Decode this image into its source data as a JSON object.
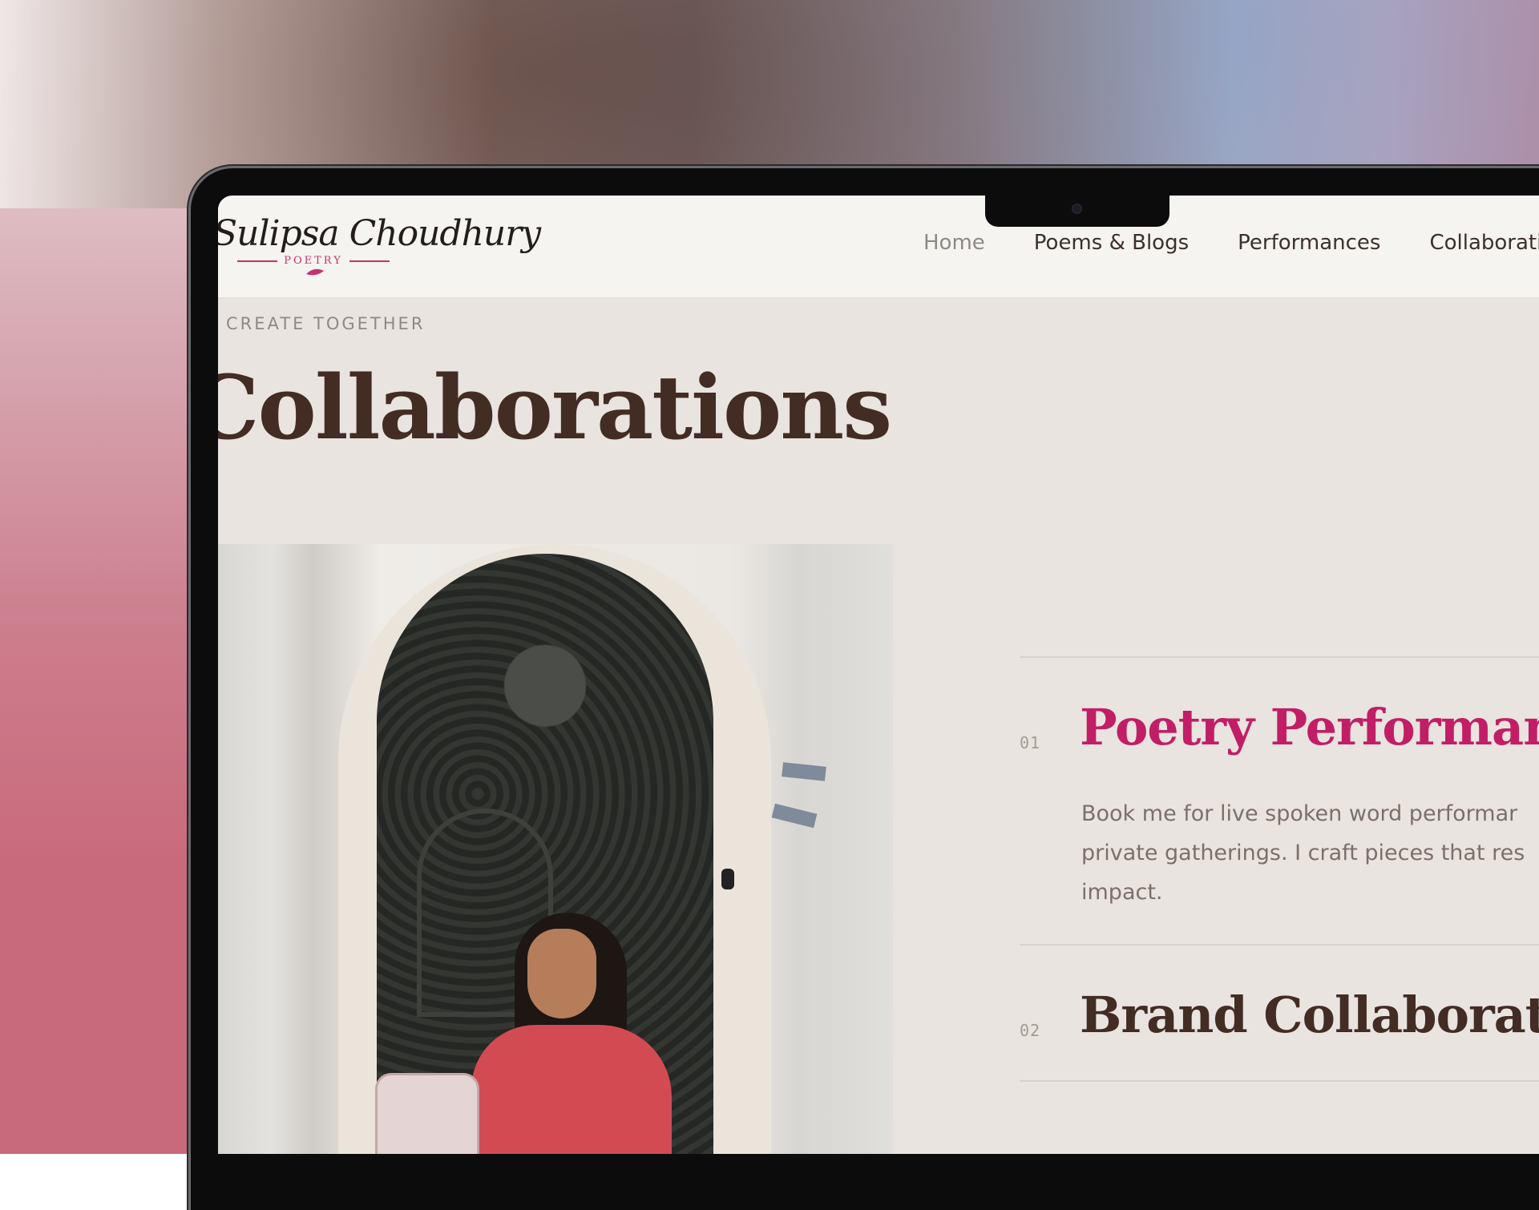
{
  "brand": {
    "name": "Sulipsa Choudhury",
    "tagline": "POETRY",
    "accent_color": "#c11e66",
    "title_color": "#432c24"
  },
  "nav": {
    "items": [
      {
        "label": "Home",
        "state": "default"
      },
      {
        "label": "Poems & Blogs",
        "state": "default"
      },
      {
        "label": "Performances",
        "state": "default"
      },
      {
        "label": "Collaboratio",
        "state": "truncated"
      }
    ]
  },
  "hero": {
    "eyebrow": "CREATE TOGETHER",
    "title": "Collaborations"
  },
  "photo": {
    "description_icon": "portrait-photo"
  },
  "services": [
    {
      "number": "01",
      "title": "Poetry Performanc",
      "description": "Book me for live spoken word performar private gatherings. I craft pieces that res impact.",
      "style": "accent"
    },
    {
      "number": "02",
      "title": "Brand Collaboratio",
      "description": "",
      "style": "dark"
    }
  ]
}
